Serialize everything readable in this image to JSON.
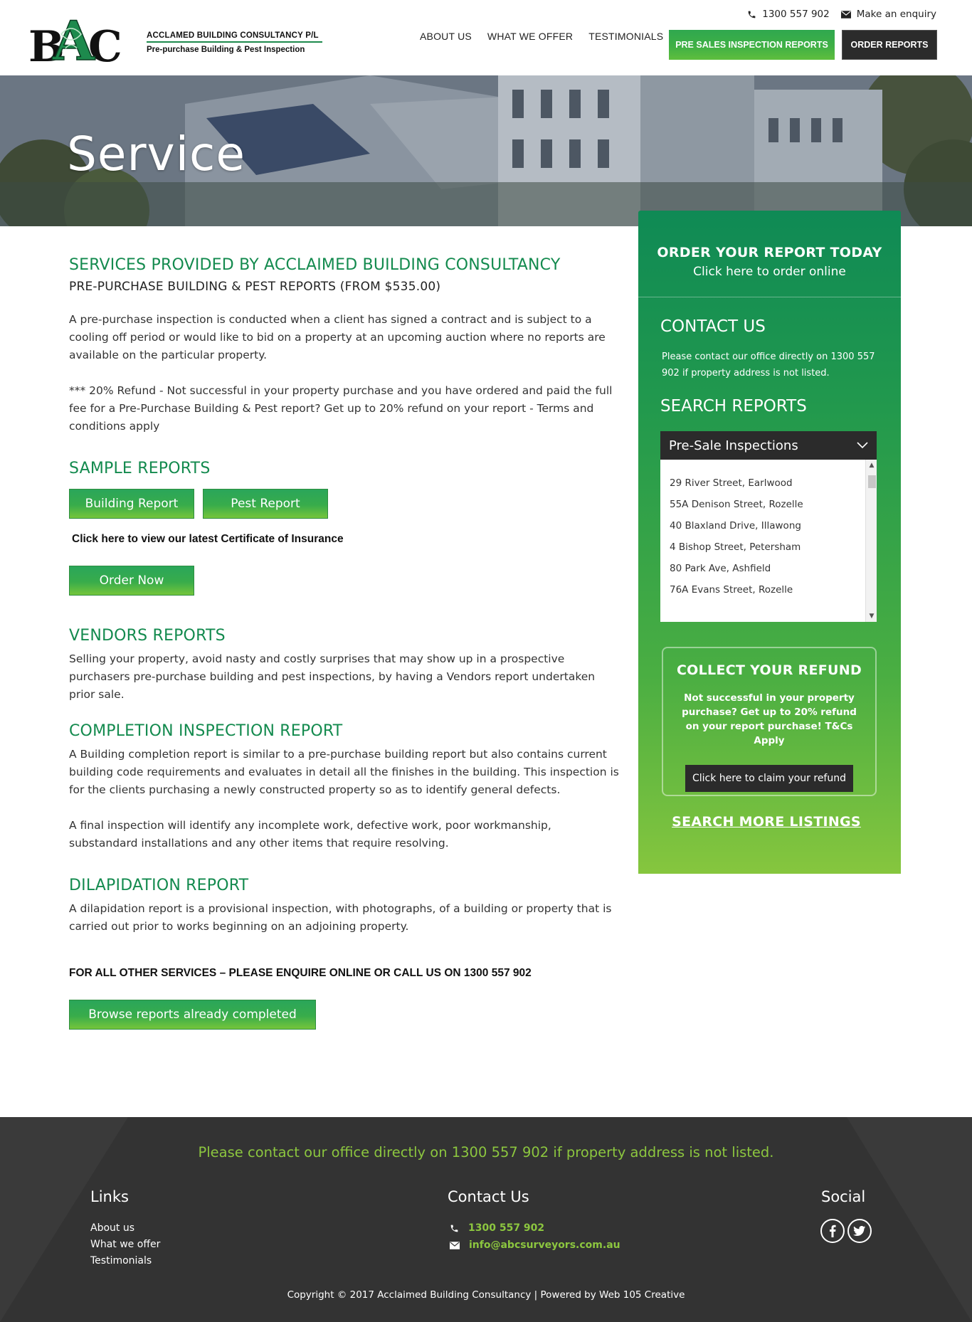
{
  "brand": {
    "logo_text": "BAC",
    "company_name": "ACCLAMED BUILDING CONSULTANCY  P/L",
    "tagline": "Pre-purchase Building & Pest Inspection"
  },
  "topbar": {
    "phone": "1300 557 902",
    "enquiry": "Make an enquiry"
  },
  "nav": {
    "items": [
      "ABOUT US",
      "WHAT WE OFFER",
      "TESTIMONIALS"
    ],
    "pre_sales": "PRE SALES INSPECTION REPORTS",
    "order": "ORDER REPORTS"
  },
  "hero": {
    "title": "Service"
  },
  "main": {
    "heading": "SERVICES PROVIDED BY ACCLAIMED BUILDING CONSULTANCY",
    "subheading": "PRE-PURCHASE BUILDING & PEST REPORTS (FROM $535.00)",
    "intro": "A pre-purchase inspection is conducted when a client has signed a contract and is subject to a cooling off period or would like to bid on a property at an upcoming auction where no reports are available on the particular property.",
    "refund_note": "*** 20% Refund - Not successful in your property purchase and you have ordered and paid the full fee for a Pre-Purchase Building & Pest report? Get up to 20% refund on your report - Terms and conditions apply",
    "sample_heading": "SAMPLE REPORTS",
    "building_report": "Building Report",
    "pest_report": "Pest Report",
    "insurance_link": "Click here to view our latest Certificate of Insurance",
    "order_now": "Order Now",
    "vendors_heading": "VENDORS REPORTS",
    "vendors_text": "Selling your property, avoid nasty and costly surprises that may show up in a prospective purchasers pre-purchase building and pest inspections, by having a Vendors report undertaken prior sale.",
    "completion_heading": "COMPLETION INSPECTION REPORT",
    "completion_text1": "A Building completion report is similar to a pre-purchase building report but also contains current building code requirements and evaluates in detail all the finishes in the building. This inspection is for the clients purchasing a newly constructed property so as to identify general defects.",
    "completion_text2": "A final inspection will identify any incomplete work, defective work, poor workmanship, substandard installations and any other items that require resolving.",
    "dilapidation_heading": "DILAPIDATION REPORT",
    "dilapidation_text": "A dilapidation report is a provisional inspection, with photographs, of a building or property that is carried out prior to works beginning on an adjoining property.",
    "other_services": "FOR ALL OTHER SERVICES – PLEASE ENQUIRE ONLINE OR CALL US ON 1300 557 902",
    "browse_button": "Browse reports already completed"
  },
  "sidebar": {
    "order_title": "ORDER YOUR REPORT TODAY",
    "order_sub": "Click here to order online",
    "contact_heading": "CONTACT US",
    "contact_text": "Please contact our office directly on 1300 557 902 if property address is not listed.",
    "search_heading": "SEARCH REPORTS",
    "select_value": "Pre-Sale Inspections",
    "listings": [
      "29 River Street, Earlwood",
      "55A Denison Street, Rozelle",
      "40 Blaxland Drive, Illawong",
      "4 Bishop Street, Petersham",
      "80 Park Ave, Ashfield",
      "76A Evans Street, Rozelle"
    ],
    "refund_title": "COLLECT YOUR REFUND",
    "refund_text": "Not successful in your property purchase? Get up to 20% refund on your report purchase! T&Cs Apply",
    "refund_button": "Click here to claim your refund",
    "search_more": "SEARCH MORE LISTINGS"
  },
  "footer": {
    "message": "Please contact our office directly on 1300 557 902 if property address is not listed.",
    "links_heading": "Links",
    "links": [
      "About us",
      "What we offer",
      "Testimonials"
    ],
    "contact_heading": "Contact Us",
    "phone": "1300 557 902",
    "email": "info@abcsurveyors.com.au",
    "social_heading": "Social",
    "copyright": "Copyright © 2017 Acclaimed Building Consultancy | Powered by Web 105 Creative"
  },
  "colors": {
    "brand_green": "#138a4e",
    "accent_green": "#3fb045",
    "footer_green": "#8cc63f",
    "dark": "#2b2b2b",
    "footer_bg": "#333333"
  },
  "icons": [
    "phone-icon",
    "mail-icon",
    "chevron-down-icon",
    "facebook-icon",
    "twitter-icon"
  ]
}
